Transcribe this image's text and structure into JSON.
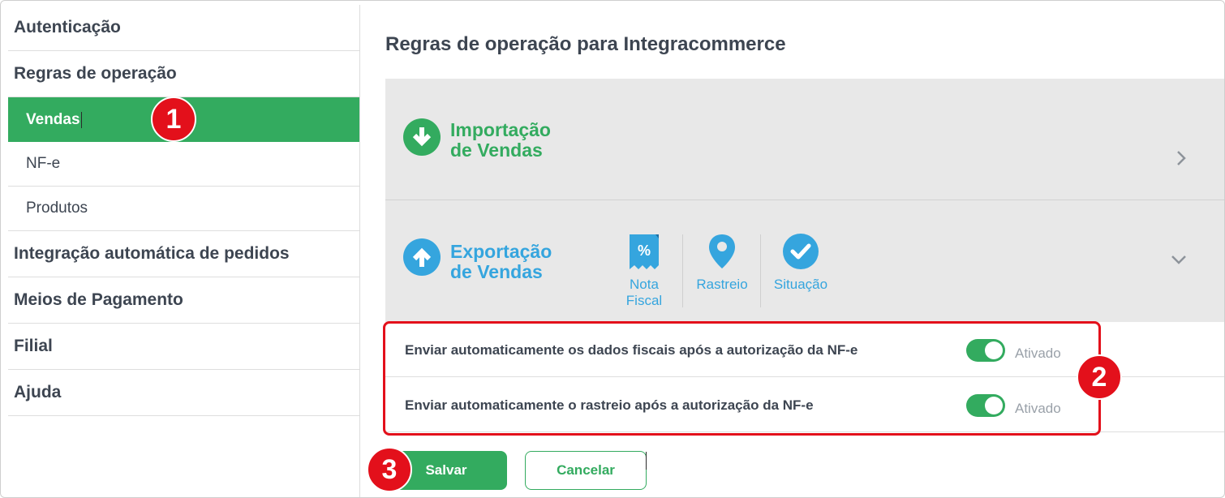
{
  "sidebar": {
    "items": [
      {
        "label": "Autenticação"
      },
      {
        "label": "Regras de operação"
      },
      {
        "label": "Integração automática de pedidos"
      },
      {
        "label": "Meios de Pagamento"
      },
      {
        "label": "Filial"
      },
      {
        "label": "Ajuda"
      }
    ],
    "subitems": [
      {
        "label": "Vendas",
        "active": true
      },
      {
        "label": "NF-e",
        "active": false
      },
      {
        "label": "Produtos",
        "active": false
      }
    ]
  },
  "main": {
    "title": "Regras de operação para Integracommerce",
    "import_panel": {
      "line1": "Importação",
      "line2": "de Vendas",
      "icon": "download-circle-icon",
      "chevron": "chevron-right-icon"
    },
    "export_panel": {
      "line1": "Exportação",
      "line2": "de Vendas",
      "icon": "upload-circle-icon",
      "chevron": "chevron-down-icon",
      "tabs": [
        {
          "label_line1": "Nota",
          "label_line2": "Fiscal",
          "icon": "receipt-percent-icon"
        },
        {
          "label": "Rastreio",
          "icon": "location-pin-icon"
        },
        {
          "label": "Situação",
          "icon": "check-circle-icon"
        }
      ]
    },
    "settings": [
      {
        "label": "Enviar automaticamente os dados fiscais após a autorização da NF-e",
        "status": "Ativado",
        "enabled": true
      },
      {
        "label": "Enviar automaticamente o rastreio após a autorização da NF-e",
        "status": "Ativado",
        "enabled": true
      }
    ],
    "buttons": {
      "save": "Salvar",
      "cancel": "Cancelar"
    }
  },
  "annotations": {
    "badge1": "1",
    "badge2": "2",
    "badge3": "3"
  },
  "colors": {
    "green": "#33ab5f",
    "blue": "#35a5de",
    "red": "#e3101b",
    "panel": "#e8e8e8"
  }
}
